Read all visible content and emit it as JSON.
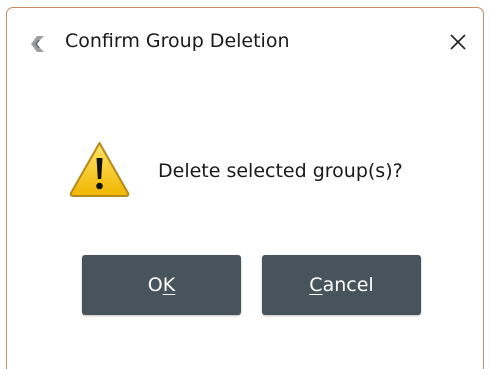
{
  "dialog": {
    "title": "Confirm Group Deletion",
    "message": "Delete selected group(s)?",
    "icons": {
      "app": "app-c-logo-icon",
      "warning": "warning-triangle-icon",
      "close": "close-x-icon"
    },
    "buttons": {
      "ok": {
        "pre": "O",
        "mnemonic": "K",
        "post": ""
      },
      "cancel": {
        "pre": "",
        "mnemonic": "C",
        "post": "ancel"
      }
    },
    "colors": {
      "button_bg": "#47545b",
      "window_border": "#c98d67",
      "warning_fill": "#f5c400"
    }
  }
}
